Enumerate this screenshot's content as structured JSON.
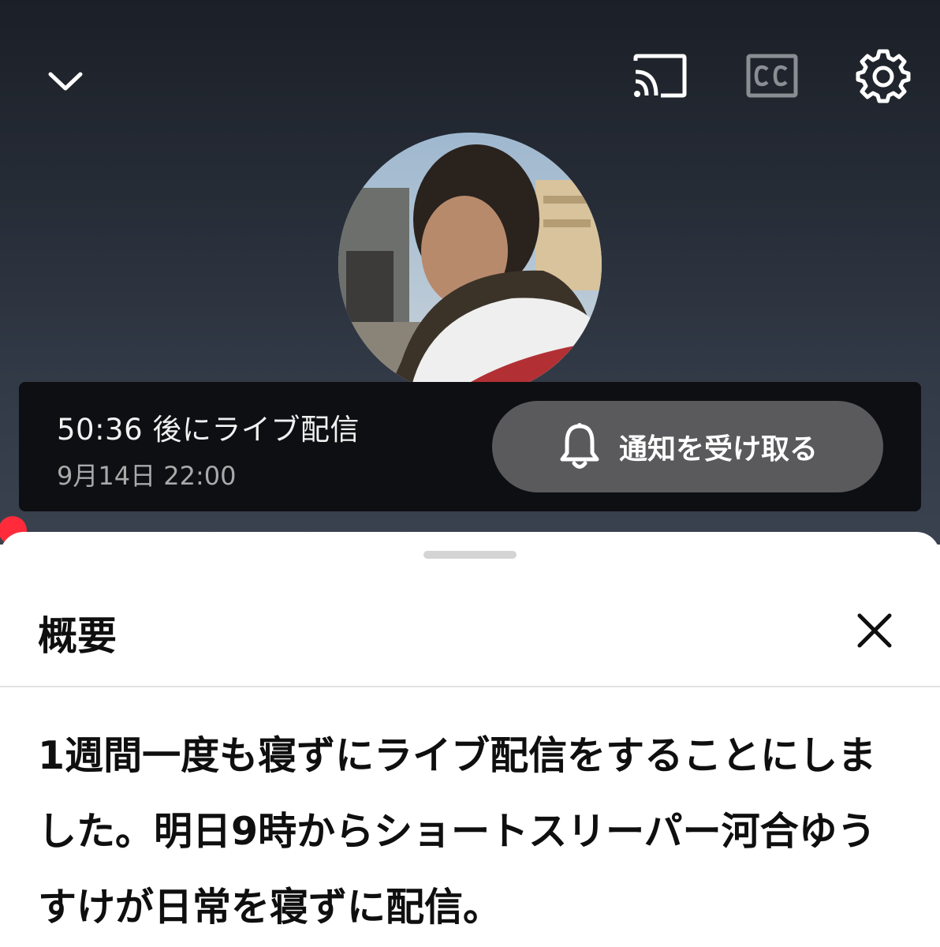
{
  "player": {
    "countdown": "50:36 後にライブ配信",
    "schedule": "9月14日 22:00",
    "notify_label": "通知を受け取る"
  },
  "icons": {
    "collapse": "chevron-down-icon",
    "cast": "cast-icon",
    "captions": "cc-icon",
    "settings": "gear-icon",
    "notify": "bell-icon",
    "close": "close-icon"
  },
  "description_panel": {
    "title": "概要",
    "text": "1週間一度も寝ずにライブ配信をすることにしました。明日9時からショートスリーパー河合ゆうすけが日常を寝ずに配信。"
  },
  "colors": {
    "progress_accent": "#ff2b3a",
    "banner_bg": "#0e0f12",
    "notify_button_bg": "#5a5a5c"
  }
}
